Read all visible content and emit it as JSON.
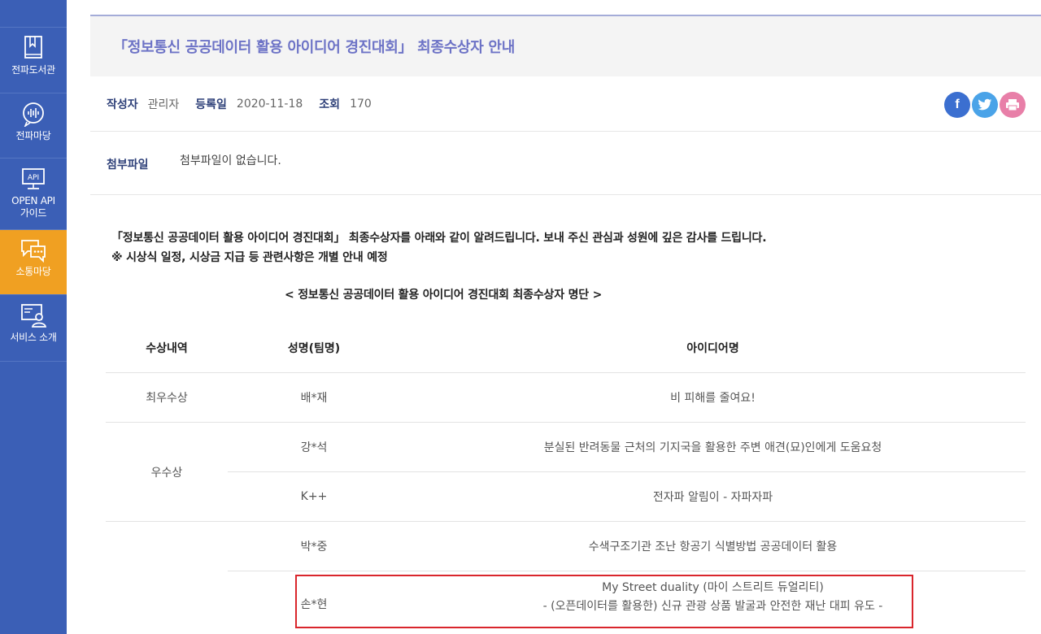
{
  "sidebar": {
    "items": [
      {
        "label": "전파도서관",
        "icon": "book-icon"
      },
      {
        "label": "전파마당",
        "icon": "speech-wave-icon"
      },
      {
        "label": "OPEN API\n가이드",
        "icon": "api-monitor-icon"
      },
      {
        "label": "소통마당",
        "icon": "chat-bubbles-icon"
      },
      {
        "label": "서비스 소개",
        "icon": "service-person-icon"
      }
    ],
    "active_index": 3,
    "colors": {
      "background": "#3b5fb6",
      "active": "#f0a022"
    }
  },
  "post": {
    "title": "「정보통신 공공데이터 활용 아이디어 경진대회」 최종수상자 안내",
    "author_label": "작성자",
    "author": "관리자",
    "date_label": "등록일",
    "date": "2020-11-18",
    "views_label": "조회",
    "views": "170",
    "attachment_label": "첨부파일",
    "attachment_value": "첨부파일이 없습니다.",
    "body_line1": "「정보통신 공공데이터 활용 아이디어 경진대회」 최종수상자를 아래와 같이 알려드립니다. 보내 주신 관심과 성원에 깊은 감사를 드립니다.",
    "body_line2": "※ 시상식 일정, 시상금 지급 등 관련사항은 개별 안내 예정",
    "list_heading": "< 정보통신 공공데이터 활용 아이디어 경진대회 최종수상자 명단 >"
  },
  "share": {
    "facebook_icon": "f",
    "colors": {
      "facebook": "#3b6fd0",
      "twitter": "#4aa3e8",
      "print": "#e87fa8"
    }
  },
  "table": {
    "headers": [
      "수상내역",
      "성명(팀명)",
      "아이디어명"
    ],
    "rows": [
      {
        "award": "최우수상",
        "name": "배*재",
        "idea": "비 피해를 줄여요!"
      },
      {
        "award": "우수상",
        "name": "강*석",
        "idea": "분실된 반려동물 근처의 기지국을 활용한 주변 애견(묘)인에게 도움요청"
      },
      {
        "award": "",
        "name": "K++",
        "idea": "전자파 알림이 - 자파자파"
      },
      {
        "award": "",
        "name": "박*중",
        "idea": "수색구조기관 조난 항공기 식별방법 공공데이터 활용"
      },
      {
        "award": "",
        "name": "손*현",
        "idea": "My Street duality (마이 스트리트 듀얼리티)",
        "idea_sub": "- (오픈데이터를 활용한) 신규 관광 상품 발굴과 안전한 재난 대피 유도 -"
      }
    ]
  },
  "highlight_color": "#d9262c"
}
